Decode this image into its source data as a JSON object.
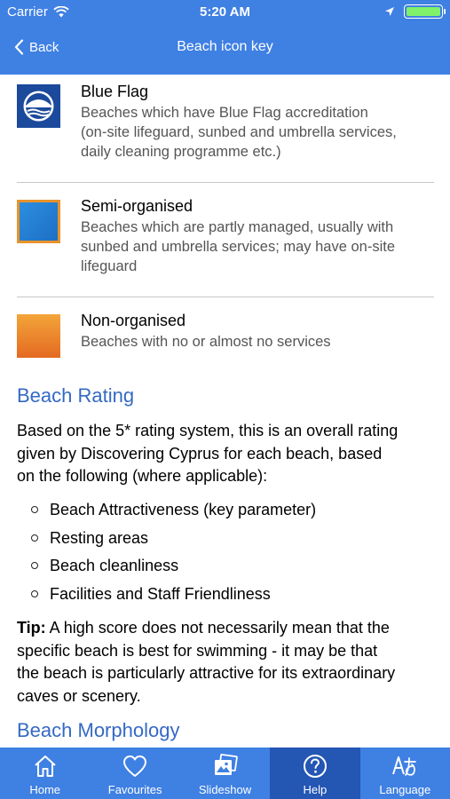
{
  "status_bar": {
    "carrier": "Carrier",
    "time": "5:20 AM",
    "battery_level": 1.0
  },
  "nav": {
    "back_label": "Back",
    "title": "Beach icon key"
  },
  "key_items": [
    {
      "title": "Blue Flag",
      "desc_lines": [
        "Beaches which have Blue Flag accreditation",
        "(on-site lifeguard, sunbed and umbrella services,",
        "daily cleaning programme etc.)"
      ],
      "icon": "blue-flag-icon"
    },
    {
      "title": "Semi-organised",
      "desc_lines": [
        "Beaches which are partly managed, usually with",
        "sunbed and umbrella services; may have on-site",
        "lifeguard"
      ],
      "icon": "semi-organised-icon"
    },
    {
      "title": "Non-organised",
      "desc_lines": [
        "Beaches with no or almost no services"
      ],
      "icon": "non-organised-icon"
    }
  ],
  "rating": {
    "heading": "Beach Rating",
    "intro_lines": [
      "Based on the 5* rating system, this is an overall rating",
      "given by Discovering Cyprus for each beach, based",
      "on the following (where applicable):"
    ],
    "bullets": [
      "Beach Attractiveness (key parameter)",
      "Resting areas",
      "Beach cleanliness",
      "Facilities and Staff Friendliness"
    ],
    "tip_label": "Tip:",
    "tip_lines": [
      " A high score does not necessarily mean that the",
      "specific beach is best for swimming - it may be that",
      "the beach is particularly attractive for its extraordinary",
      "caves or scenery."
    ]
  },
  "morphology": {
    "heading": "Beach Morphology"
  },
  "tabs": [
    {
      "label": "Home",
      "icon": "home-icon",
      "active": false
    },
    {
      "label": "Favourites",
      "icon": "heart-icon",
      "active": false
    },
    {
      "label": "Slideshow",
      "icon": "slideshow-icon",
      "active": false
    },
    {
      "label": "Help",
      "icon": "help-icon",
      "active": true
    },
    {
      "label": "Language",
      "icon": "language-icon",
      "active": false
    }
  ],
  "colors": {
    "accent": "#3f80e3",
    "active_tab": "#2456b3",
    "heading": "#3569c4"
  }
}
